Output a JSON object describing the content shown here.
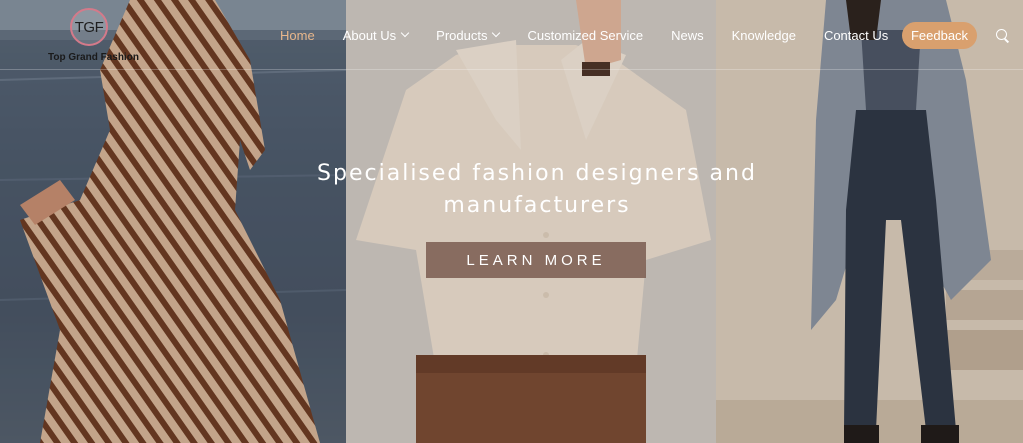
{
  "brand": {
    "logo_initials": "TGF",
    "logo_name": "Top Grand Fashion"
  },
  "nav": {
    "items": [
      {
        "label": "Home",
        "active": true,
        "has_dropdown": false
      },
      {
        "label": "About Us",
        "active": false,
        "has_dropdown": true
      },
      {
        "label": "Products",
        "active": false,
        "has_dropdown": true
      },
      {
        "label": "Customized Service",
        "active": false,
        "has_dropdown": false
      },
      {
        "label": "News",
        "active": false,
        "has_dropdown": false
      },
      {
        "label": "Knowledge",
        "active": false,
        "has_dropdown": false
      },
      {
        "label": "Contact Us",
        "active": false,
        "has_dropdown": false
      }
    ],
    "feedback_label": "Feedback",
    "search_icon": "search-icon"
  },
  "hero": {
    "headline_line1": "Specialised fashion designers and",
    "headline_line2": "manufacturers",
    "cta_label": "LEARN MORE"
  },
  "colors": {
    "accent": "#e7b68b",
    "feedback_bg": "#d9a06e",
    "cta_bg": "#7a5c50"
  }
}
